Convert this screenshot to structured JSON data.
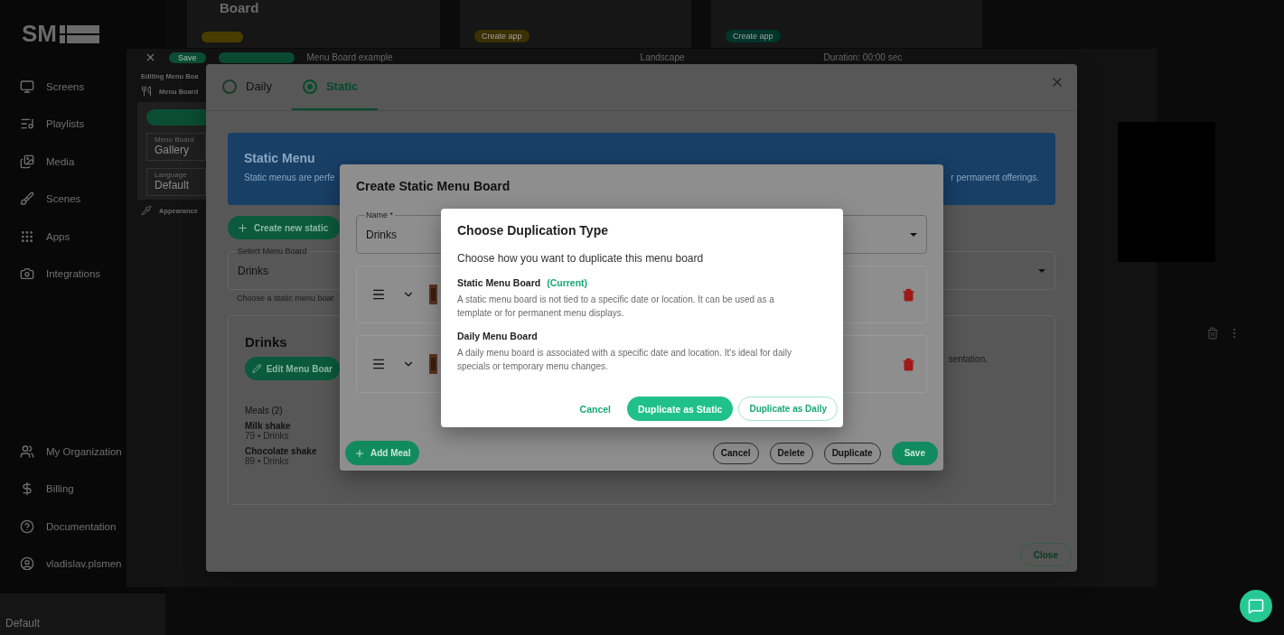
{
  "sidebar": {
    "logo": "SM",
    "items": [
      {
        "label": "Screens"
      },
      {
        "label": "Playlists"
      },
      {
        "label": "Media"
      },
      {
        "label": "Scenes"
      },
      {
        "label": "Apps"
      },
      {
        "label": "Integrations"
      }
    ],
    "bottom_items": [
      {
        "label": "My Organization"
      },
      {
        "label": "Billing"
      },
      {
        "label": "Documentation"
      },
      {
        "label": "vladislav.plsmen"
      }
    ],
    "workspace": "Default"
  },
  "background_cards": [
    {
      "title": "Board"
    },
    {
      "button": "Create app",
      "color": "#3a3000"
    },
    {
      "button": "Create app",
      "color": "#00352a"
    }
  ],
  "editor": {
    "save": "Save",
    "title": "Menu Board example",
    "orientation": "Landscape",
    "duration": "Duration: 00:00 sec",
    "heading": "Editing Menu Boa",
    "section": "Menu Board",
    "fields": [
      {
        "label": "Menu Board",
        "value": "Gallery"
      },
      {
        "label": "Language",
        "value": "Default"
      }
    ],
    "appearance": "Appearance"
  },
  "menu_dialog": {
    "tabs": [
      {
        "label": "Daily",
        "selected": false
      },
      {
        "label": "Static",
        "selected": true
      }
    ],
    "banner": {
      "title": "Static Menu",
      "text_start": "Static menus are perfe",
      "text_end": "r permanent offerings."
    },
    "create_button": "Create new static",
    "select": {
      "label": "Select Menu Board",
      "value": "Drinks",
      "helper": "Choose a static menu boar"
    },
    "board_card": {
      "title": "Drinks",
      "edit_button": "Edit Menu Boar",
      "meals_heading": "Meals (2)",
      "meals": [
        {
          "name": "Milk shake",
          "detail": "79 • Drinks"
        },
        {
          "name": "Chocolate shake",
          "detail": "89 • Drinks"
        }
      ],
      "note_end": "sentation."
    },
    "close_button": "Close"
  },
  "create_dialog": {
    "title": "Create Static Menu Board",
    "name_field": {
      "label": "Name *",
      "value": "Drinks"
    },
    "meal_rows": [
      {
        "kind": "meal"
      },
      {
        "kind": "meal"
      }
    ],
    "add_button": "Add Meal",
    "actions": [
      {
        "label": "Cancel",
        "kind": "outline"
      },
      {
        "label": "Delete",
        "kind": "outline"
      },
      {
        "label": "Duplicate",
        "kind": "outline"
      },
      {
        "label": "Save",
        "kind": "primary"
      }
    ]
  },
  "duplicate_dialog": {
    "title": "Choose Duplication Type",
    "intro": "Choose how you want to duplicate this menu board",
    "options": [
      {
        "title": "Static Menu Board",
        "badge": "(Current)",
        "text": "A static menu board is not tied to a specific date or location. It can be used as a template or for permanent menu displays."
      },
      {
        "title": "Daily Menu Board",
        "text": "A daily menu board is associated with a specific date and location. It's ideal for daily specials or temporary menu changes."
      }
    ],
    "actions": [
      {
        "label": "Cancel",
        "kind": "text"
      },
      {
        "label": "Duplicate as Static",
        "kind": "primary"
      },
      {
        "label": "Duplicate as Daily",
        "kind": "outline"
      }
    ]
  }
}
